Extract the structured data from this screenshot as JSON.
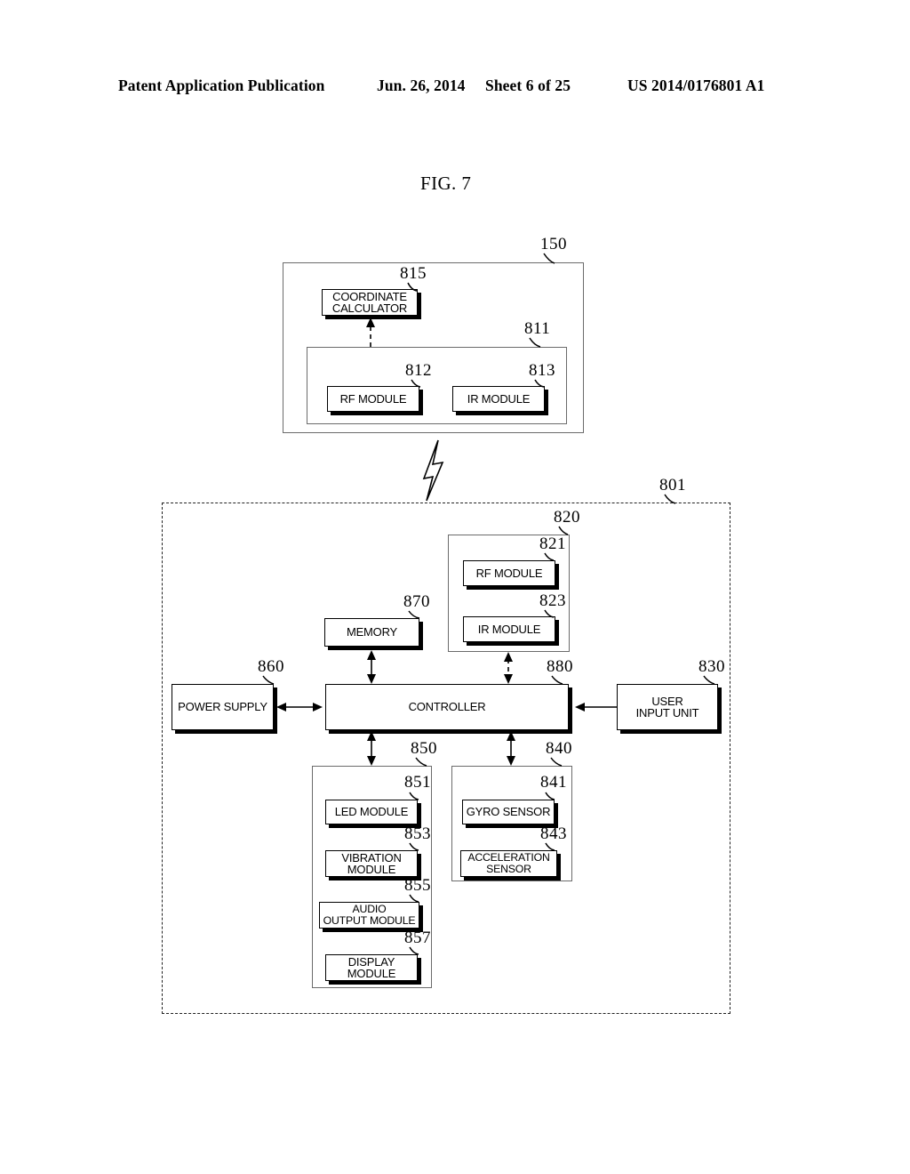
{
  "header": {
    "publication": "Patent Application Publication",
    "date": "Jun. 26, 2014",
    "sheet": "Sheet 6 of 25",
    "patent_number": "US 2014/0176801 A1"
  },
  "figure": {
    "title": "FIG. 7"
  },
  "display_device": {
    "ref": "150",
    "wireless_unit": {
      "ref": "811",
      "modules": [
        {
          "ref": "812",
          "label": "RF MODULE"
        },
        {
          "ref": "813",
          "label": "IR MODULE"
        }
      ]
    },
    "coordinate_calculator": {
      "ref": "815",
      "label": "COORDINATE\nCALCULATOR"
    }
  },
  "remote_controller": {
    "ref": "801",
    "wireless_unit": {
      "ref": "820",
      "modules": [
        {
          "ref": "821",
          "label": "RF MODULE"
        },
        {
          "ref": "823",
          "label": "IR MODULE"
        }
      ]
    },
    "memory": {
      "ref": "870",
      "label": "MEMORY"
    },
    "power_supply": {
      "ref": "860",
      "label": "POWER SUPPLY"
    },
    "controller": {
      "ref": "880",
      "label": "CONTROLLER"
    },
    "user_input_unit": {
      "ref": "830",
      "label": "USER\nINPUT UNIT"
    },
    "output_unit": {
      "ref": "850",
      "modules": [
        {
          "ref": "851",
          "label": "LED MODULE"
        },
        {
          "ref": "853",
          "label": "VIBRATION\nMODULE"
        },
        {
          "ref": "855",
          "label": "AUDIO\nOUTPUT MODULE"
        },
        {
          "ref": "857",
          "label": "DISPLAY\nMODULE"
        }
      ]
    },
    "sensor_unit": {
      "ref": "840",
      "modules": [
        {
          "ref": "841",
          "label": "GYRO SENSOR"
        },
        {
          "ref": "843",
          "label": "ACCELERATION\nSENSOR"
        }
      ]
    }
  },
  "colors": {
    "line": "#000000",
    "container_border": "#6b6b6b",
    "background": "#ffffff"
  }
}
